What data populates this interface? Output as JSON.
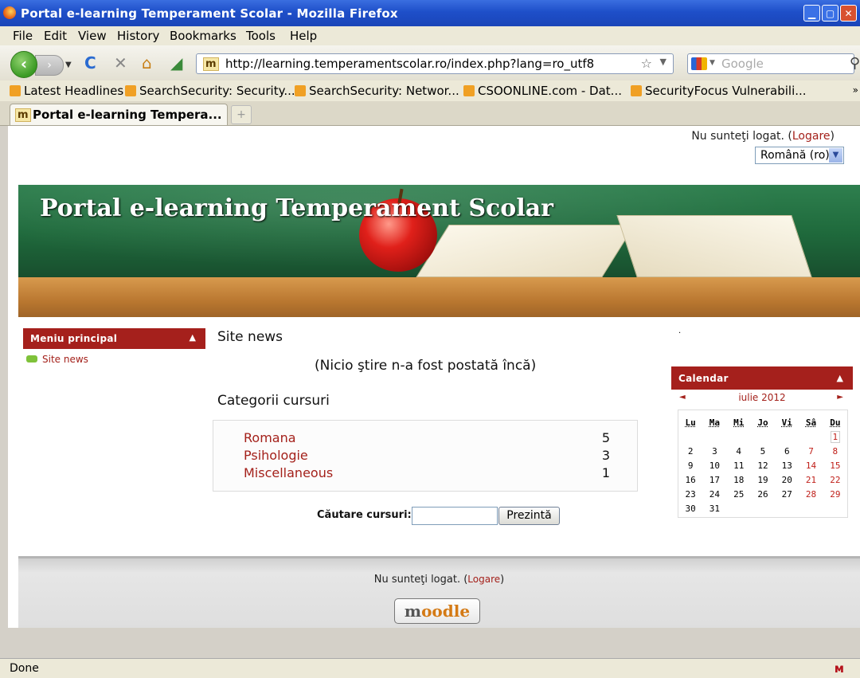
{
  "window": {
    "title": "Portal e-learning Temperament Scolar - Mozilla Firefox"
  },
  "menu": {
    "file": "File",
    "edit": "Edit",
    "view": "View",
    "history": "History",
    "bookmarks": "Bookmarks",
    "tools": "Tools",
    "help": "Help"
  },
  "navigation": {
    "url": "http://learning.temperamentscolar.ro/index.php?lang=ro_utf8",
    "search_placeholder": "Google",
    "favicon_text": "m"
  },
  "bookmarks_bar": [
    "Latest Headlines",
    "SearchSecurity: Security...",
    "SearchSecurity: Networ...",
    "CSOONLINE.com - Dat...",
    "SecurityFocus Vulnerabili..."
  ],
  "tab": {
    "title": "Portal e-learning Tempera..."
  },
  "header": {
    "login_text": "Nu sunteţi logat. (",
    "login_link": "Logare",
    "login_close": ")",
    "language": "Română (ro)"
  },
  "banner": {
    "title": "Portal e-learning Temperament Scolar"
  },
  "main_menu": {
    "title": "Meniu principal",
    "items": [
      {
        "label": "Site news"
      }
    ]
  },
  "site_news": {
    "title": "Site news",
    "empty_message": "(Nicio ştire n-a fost postată încă)"
  },
  "categories": {
    "title": "Categorii cursuri",
    "items": [
      {
        "name": "Romana",
        "count": "5"
      },
      {
        "name": "Psihologie",
        "count": "3"
      },
      {
        "name": "Miscellaneous",
        "count": "1"
      }
    ]
  },
  "course_search": {
    "label": "Căutare cursuri:",
    "button": "Prezintă"
  },
  "calendar": {
    "title": "Calendar",
    "month": "iulie 2012",
    "prev": "◄",
    "next": "►",
    "weekdays": [
      "Lu",
      "Ma",
      "Mi",
      "Jo",
      "Vi",
      "Sâ",
      "Du"
    ],
    "weeks": [
      [
        "",
        "",
        "",
        "",
        "",
        "",
        "1"
      ],
      [
        "2",
        "3",
        "4",
        "5",
        "6",
        "7",
        "8"
      ],
      [
        "9",
        "10",
        "11",
        "12",
        "13",
        "14",
        "15"
      ],
      [
        "16",
        "17",
        "18",
        "19",
        "20",
        "21",
        "22"
      ],
      [
        "23",
        "24",
        "25",
        "26",
        "27",
        "28",
        "29"
      ],
      [
        "30",
        "31",
        "",
        "",
        "",
        "",
        ""
      ]
    ]
  },
  "footer": {
    "login_text": "Nu sunteţi logat. (",
    "login_link": "Logare",
    "login_close": ")",
    "logo_m": "m",
    "logo_rest": "oodle"
  },
  "status": {
    "text": "Done"
  },
  "colors": {
    "accent": "#a5201c",
    "titlebar": "#1e4fc9"
  }
}
